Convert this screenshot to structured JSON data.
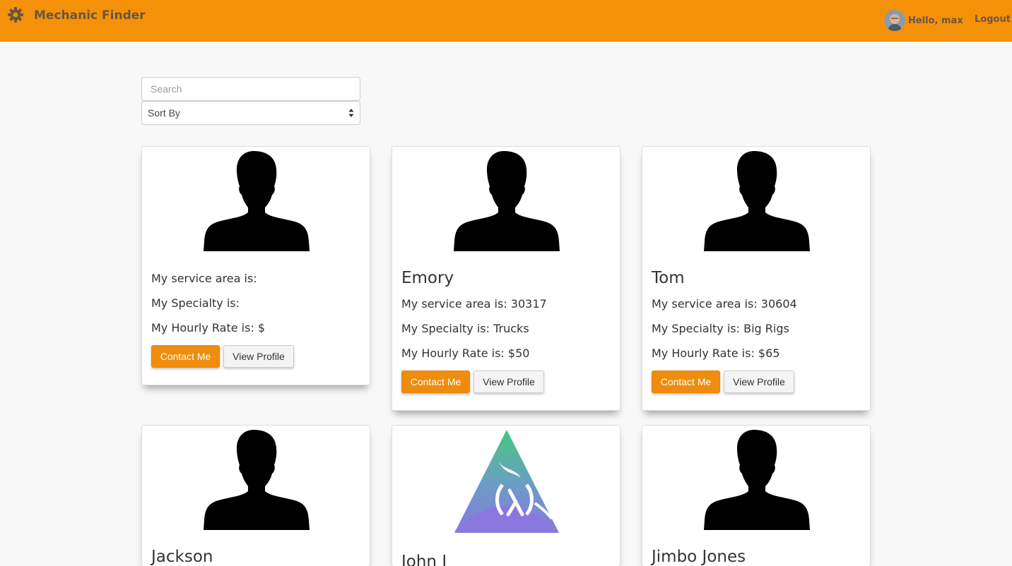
{
  "navbar": {
    "brand": "Mechanic Finder",
    "greeting": "Hello, max",
    "logout": "Logout",
    "color": "#f59109"
  },
  "filters": {
    "search_placeholder": "Search",
    "sort_label": "Sort By"
  },
  "labels": {
    "area": "My service area is: ",
    "specialty": "My Specialty is: ",
    "rate": "My Hourly Rate is: $",
    "contact": "Contact Me",
    "view": "View Profile"
  },
  "mechanics": [
    {
      "name": "",
      "area": "",
      "specialty": "",
      "rate": "",
      "image": "person-silhouette"
    },
    {
      "name": "Emory",
      "area": "30317",
      "specialty": "Trucks",
      "rate": "50",
      "image": "person-silhouette"
    },
    {
      "name": "Tom",
      "area": "30604",
      "specialty": "Big Rigs",
      "rate": "65",
      "image": "person-silhouette"
    },
    {
      "name": "Jackson",
      "image": "person-silhouette"
    },
    {
      "name": "John J",
      "image": "lambda-triangle-logo"
    },
    {
      "name": "Jimbo Jones",
      "image": "person-silhouette"
    }
  ]
}
